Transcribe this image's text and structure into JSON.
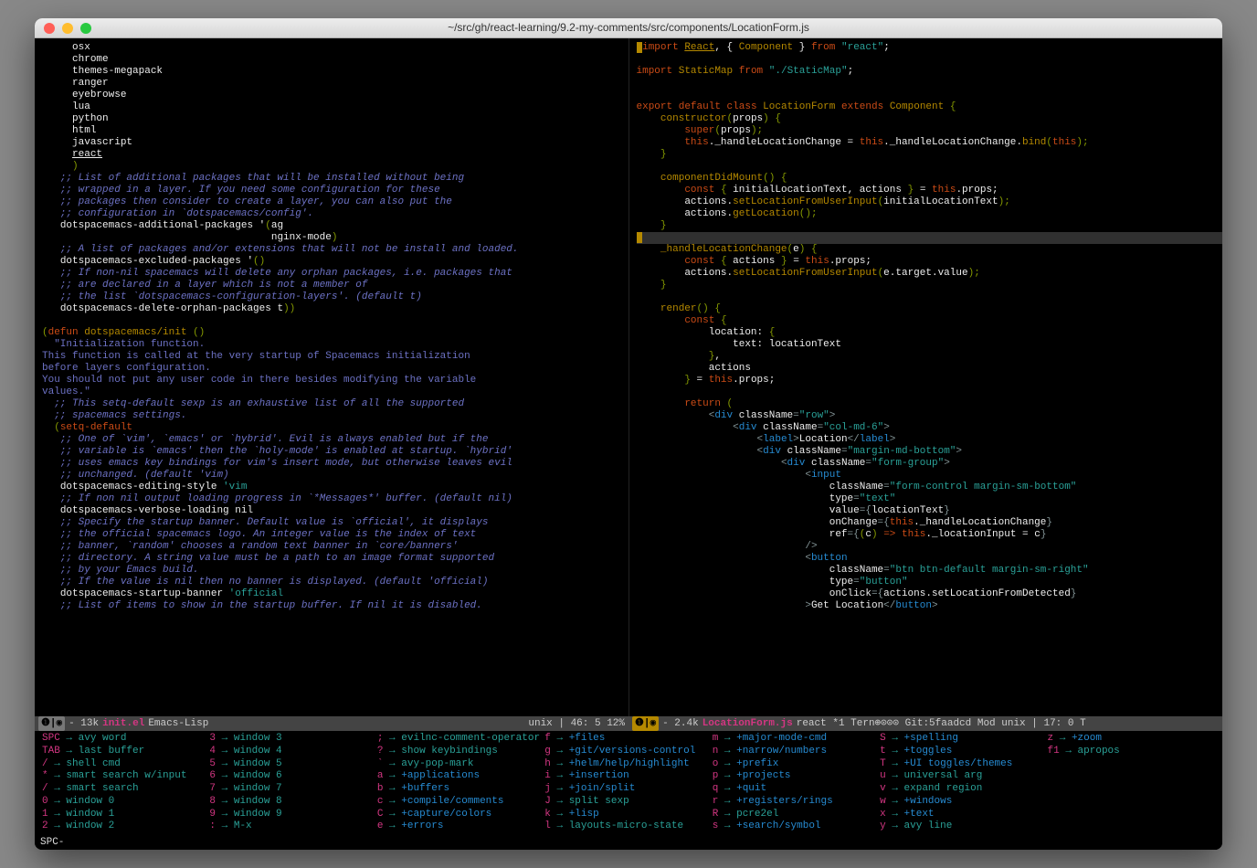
{
  "window": {
    "title": "~/src/gh/react-learning/9.2-my-comments/src/components/LocationForm.js"
  },
  "left_pane": {
    "layers": [
      "osx",
      "chrome",
      "themes-megapack",
      "ranger",
      "eyebrowse",
      "lua",
      "python",
      "html",
      "javascript",
      "react"
    ],
    "close_paren": ")",
    "comment1": ";; List of additional packages that will be installed without being",
    "comment2": ";; wrapped in a layer. If you need some configuration for these",
    "comment3": ";; packages then consider to create a layer, you can also put the",
    "comment4": ";; configuration in `dotspacemacs/config'.",
    "addl_pkg_1": "dotspacemacs-additional-packages '(ag",
    "addl_pkg_2": "                                   nginx-mode)",
    "comment5": ";; A list of packages and/or extensions that will not be install and loaded.",
    "excl_pkg": "dotspacemacs-excluded-packages '()",
    "comment6": ";; If non-nil spacemacs will delete any orphan packages, i.e. packages that",
    "comment7": ";; are declared in a layer which is not a member of",
    "comment8": ";; the list `dotspacemacs-configuration-layers'. (default t)",
    "del_orphan": "dotspacemacs-delete-orphan-packages t))",
    "defun_open": "(defun dotspacemacs/init ()",
    "doc1": "\"Initialization function.",
    "doc2": "This function is called at the very startup of Spacemacs initialization",
    "doc3": "before layers configuration.",
    "doc4": "You should not put any user code in there besides modifying the variable",
    "doc5": "values.\"",
    "comment9": ";; This setq-default sexp is an exhaustive list of all the supported",
    "comment10": ";; spacemacs settings.",
    "setq": "(setq-default",
    "comment11": ";; One of `vim', `emacs' or `hybrid'. Evil is always enabled but if the",
    "comment12": ";; variable is `emacs' then the `holy-mode' is enabled at startup. `hybrid'",
    "comment13": ";; uses emacs key bindings for vim's insert mode, but otherwise leaves evil",
    "comment14": ";; unchanged. (default 'vim)",
    "editing_style": "dotspacemacs-editing-style 'vim",
    "comment15": ";; If non nil output loading progress in `*Messages*' buffer. (default nil)",
    "verbose": "dotspacemacs-verbose-loading nil",
    "comment16": ";; Specify the startup banner. Default value is `official', it displays",
    "comment17": ";; the official spacemacs logo. An integer value is the index of text",
    "comment18": ";; banner, `random' chooses a random text banner in `core/banners'",
    "comment19": ";; directory. A string value must be a path to an image format supported",
    "comment20": ";; by your Emacs build.",
    "comment21": ";; If the value is nil then no banner is displayed. (default 'official)",
    "startup_banner": "dotspacemacs-startup-banner 'official",
    "comment22": ";; List of items to show in the startup buffer. If nil it is disabled."
  },
  "right_pane": {
    "l1": "import React, { Component } from \"react\";",
    "l2": "",
    "l3": "import StaticMap from \"./StaticMap\";",
    "l4": "",
    "l5": "",
    "l6": "export default class LocationForm extends Component {",
    "l7": "    constructor(props) {",
    "l8": "        super(props);",
    "l9": "        this._handleLocationChange = this._handleLocationChange.bind(this);",
    "l10": "    }",
    "l11": "",
    "l12": "    componentDidMount() {",
    "l13": "        const { initialLocationText, actions } = this.props;",
    "l14": "        actions.setLocationFromUserInput(initialLocationText);",
    "l15": "        actions.getLocation();",
    "l16": "    }",
    "l17": "",
    "l18": "    _handleLocationChange(e) {",
    "l19": "        const { actions } = this.props;",
    "l20": "        actions.setLocationFromUserInput(e.target.value);",
    "l21": "    }",
    "l22": "",
    "l23": "    render() {",
    "l24": "        const {",
    "l25": "            location: {",
    "l26": "                text: locationText",
    "l27": "            },",
    "l28": "            actions",
    "l29": "        } = this.props;",
    "l30": "",
    "l31": "        return (",
    "l32": "            <div className=\"row\">",
    "l33": "                <div className=\"col-md-6\">",
    "l34": "                    <label>Location</label>",
    "l35": "                    <div className=\"margin-md-bottom\">",
    "l36": "                        <div className=\"form-group\">",
    "l37": "                            <input",
    "l38": "                                className=\"form-control margin-sm-bottom\"",
    "l39": "                                type=\"text\"",
    "l40": "                                value={locationText}",
    "l41": "                                onChange={this._handleLocationChange}",
    "l42": "                                ref={(c) => this._locationInput = c}",
    "l43": "                            />",
    "l44": "                            <button",
    "l45": "                                className=\"btn btn-default margin-sm-right\"",
    "l46": "                                type=\"button\"",
    "l47": "                                onClick={actions.setLocationFromDetected}",
    "l48": "                            >Get Location</button>"
  },
  "modeline_left": {
    "badge": "❶|◉",
    "size": "- 13k",
    "filename": "init.el",
    "mode": "Emacs-Lisp",
    "right": "unix | 46: 5  12%"
  },
  "modeline_right": {
    "badge": "❶|◉",
    "size": "- 2.4k",
    "filename": "LocationForm.js",
    "mode": "react *1  Tern⊕⊙⊙⊙   Git:5faadcd Mod  unix | 17: 0  T"
  },
  "which_key": {
    "cols": [
      [
        {
          "k": "SPC",
          "c": "avy word"
        },
        {
          "k": "TAB",
          "c": "last buffer"
        },
        {
          "k": "/",
          "c": "shell cmd"
        },
        {
          "k": "*",
          "c": "smart search w/input"
        },
        {
          "k": "/",
          "c": "smart search"
        },
        {
          "k": "0",
          "c": "window 0"
        },
        {
          "k": "1",
          "c": "window 1"
        },
        {
          "k": "2",
          "c": "window 2"
        }
      ],
      [
        {
          "k": "3",
          "c": "window 3"
        },
        {
          "k": "4",
          "c": "window 4"
        },
        {
          "k": "5",
          "c": "window 5"
        },
        {
          "k": "6",
          "c": "window 6"
        },
        {
          "k": "7",
          "c": "window 7"
        },
        {
          "k": "8",
          "c": "window 8"
        },
        {
          "k": "9",
          "c": "window 9"
        },
        {
          "k": ":",
          "c": "M-x"
        }
      ],
      [
        {
          "k": ";",
          "c": "evilnc-comment-operator"
        },
        {
          "k": "?",
          "c": "show keybindings"
        },
        {
          "k": "`",
          "c": "avy-pop-mark"
        },
        {
          "k": "a",
          "c": "+applications",
          "g": true
        },
        {
          "k": "b",
          "c": "+buffers",
          "g": true
        },
        {
          "k": "c",
          "c": "+compile/comments",
          "g": true
        },
        {
          "k": "C",
          "c": "+capture/colors",
          "g": true
        },
        {
          "k": "e",
          "c": "+errors",
          "g": true
        }
      ],
      [
        {
          "k": "f",
          "c": "+files",
          "g": true
        },
        {
          "k": "g",
          "c": "+git/versions-control",
          "g": true
        },
        {
          "k": "h",
          "c": "+helm/help/highlight",
          "g": true
        },
        {
          "k": "i",
          "c": "+insertion",
          "g": true
        },
        {
          "k": "j",
          "c": "+join/split",
          "g": true
        },
        {
          "k": "J",
          "c": "split sexp"
        },
        {
          "k": "k",
          "c": "+lisp",
          "g": true
        },
        {
          "k": "l",
          "c": "layouts-micro-state"
        }
      ],
      [
        {
          "k": "m",
          "c": "+major-mode-cmd",
          "g": true
        },
        {
          "k": "n",
          "c": "+narrow/numbers",
          "g": true
        },
        {
          "k": "o",
          "c": "+prefix",
          "g": true
        },
        {
          "k": "p",
          "c": "+projects",
          "g": true
        },
        {
          "k": "q",
          "c": "+quit",
          "g": true
        },
        {
          "k": "r",
          "c": "+registers/rings",
          "g": true
        },
        {
          "k": "R",
          "c": "pcre2el"
        },
        {
          "k": "s",
          "c": "+search/symbol",
          "g": true
        }
      ],
      [
        {
          "k": "S",
          "c": "+spelling",
          "g": true
        },
        {
          "k": "t",
          "c": "+toggles",
          "g": true
        },
        {
          "k": "T",
          "c": "+UI toggles/themes",
          "g": true
        },
        {
          "k": "u",
          "c": "universal arg"
        },
        {
          "k": "v",
          "c": "expand region"
        },
        {
          "k": "w",
          "c": "+windows",
          "g": true
        },
        {
          "k": "x",
          "c": "+text",
          "g": true
        },
        {
          "k": "y",
          "c": "avy line"
        }
      ],
      [
        {
          "k": "z",
          "c": "+zoom",
          "g": true
        },
        {
          "k": "f1",
          "c": "apropos"
        }
      ]
    ]
  },
  "minibuffer": "SPC-"
}
